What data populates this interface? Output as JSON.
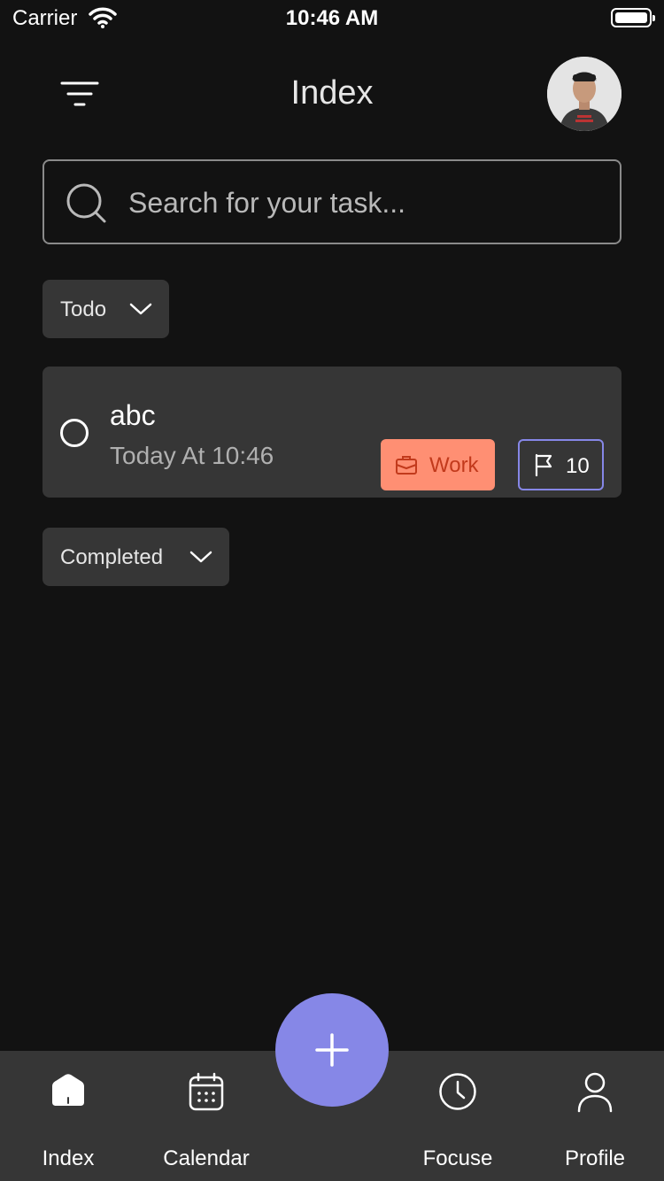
{
  "status_bar": {
    "carrier": "Carrier",
    "time": "10:46 AM"
  },
  "header": {
    "title": "Index",
    "menu_icon": "filter-lines-icon",
    "avatar": "user-avatar"
  },
  "search": {
    "placeholder": "Search for your task...",
    "value": ""
  },
  "sections": {
    "todo_label": "Todo",
    "completed_label": "Completed"
  },
  "tasks": [
    {
      "title": "abc",
      "time": "Today At 10:46",
      "category": "Work",
      "category_icon": "briefcase-icon",
      "priority": "10",
      "priority_icon": "flag-icon",
      "done": false
    }
  ],
  "bottom_nav": {
    "items": [
      {
        "label": "Index",
        "icon": "home-icon",
        "active": true
      },
      {
        "label": "Calendar",
        "icon": "calendar-icon",
        "active": false
      },
      {
        "label": "Focuse",
        "icon": "clock-icon",
        "active": false
      },
      {
        "label": "Profile",
        "icon": "user-icon",
        "active": false
      }
    ],
    "fab_icon": "plus-icon"
  },
  "colors": {
    "background": "#121212",
    "surface": "#363636",
    "accent": "#8687e7",
    "work_chip_bg": "#ff8f73",
    "work_chip_text": "#c23a1c"
  }
}
